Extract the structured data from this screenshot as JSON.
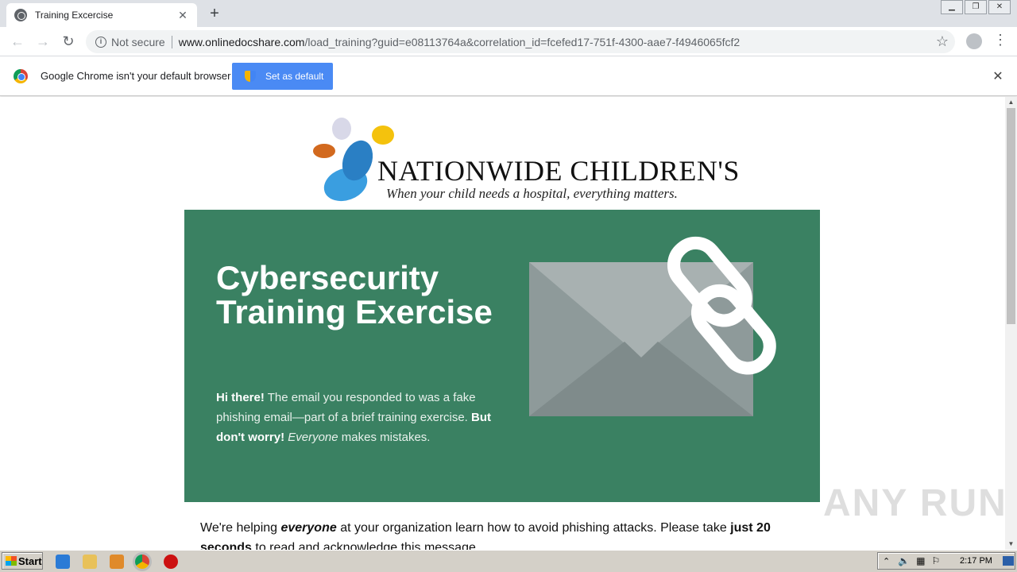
{
  "browser": {
    "tab_title": "Training Excercise",
    "not_secure": "Not secure",
    "url_host": "www.onlinedocshare.com",
    "url_rest": "/load_training?guid=e08113764a&correlation_id=fcefed17-751f-4300-aae7-f4946065fcf2",
    "infobar_text": "Google Chrome isn't your default browser",
    "set_default_label": "Set as default"
  },
  "page": {
    "logo_name": "NATIONWIDE CHILDREN'S",
    "logo_tagline": "When your child needs a hospital, everything matters.",
    "hero_title": "Cybersecurity Training Exercise",
    "hero_greeting": "Hi there!",
    "hero_line1": " The email you responded to was a fake phishing email—part of a brief training exercise.",
    "hero_worry": "But don't worry!",
    "hero_everyone": "Everyone",
    "hero_line2": " makes mistakes.",
    "intro_1": "We're helping ",
    "intro_everyone": "everyone",
    "intro_2": " at your organization learn how to avoid phishing attacks. Please take ",
    "intro_time": "just 20 seconds",
    "intro_3": " to read and acknowledge this message."
  },
  "watermark": "ANY RUN",
  "taskbar": {
    "start_label": "Start",
    "clock": "2:17 PM"
  },
  "colors": {
    "hero_green": "#3a8162",
    "chrome_blue": "#4a8af4"
  }
}
